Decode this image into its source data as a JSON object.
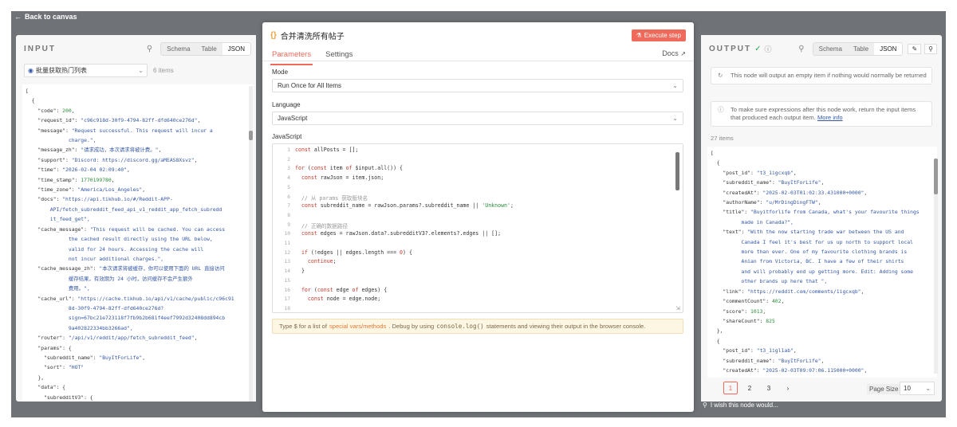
{
  "nav": {
    "back_label": "Back to canvas",
    "back_icon": "arrow-left-icon"
  },
  "input": {
    "title": "INPUT",
    "view_tabs": [
      "Schema",
      "Table",
      "JSON"
    ],
    "active_view": "JSON",
    "node_select": "批量获取热门列表",
    "items_count": "6 items",
    "json_lines": [
      "[",
      "  {",
      "    \"code\": 200,",
      "    \"request_id\": \"c96c918d-30f9-4794-82ff-dfd640ce276d\",",
      "    \"message\": \"Request successful. This request will incur a",
      "              charge.\",",
      "    \"message_zh\": \"请求成功，本次请求将被计费。\",",
      "    \"support\": \"Discord: https://discord.gg/aMEAS8Xsvz\",",
      "    \"time\": \"2026-02-04 02:09:40\",",
      "    \"time_stamp\": 1770199780,",
      "    \"time_zone\": \"America/Los_Angeles\",",
      "    \"docs\": \"https://api.tikhub.io/#/Reddit-APP-",
      "        API/fetch_subreddit_feed_api_v1_reddit_app_fetch_subredd",
      "        it_feed_get\",",
      "    \"cache_message\": \"This request will be cached. You can access",
      "              the cached result directly using the URL below,",
      "              valid for 24 hours. Accessing the cache will",
      "              not incur additional charges.\",",
      "    \"cache_message_zh\": \"本次请求将被缓存，你可以使用下面的 URL 直接访问",
      "              缓存结果，有效期为 24 小时，访问缓存不会产生额外",
      "              费用。\",",
      "    \"cache_url\": \"https://cache.tikhub.io/api/v1/cache/public/c96c91",
      "              8d-30f9-4794-82ff-dfd640ce276d?",
      "              sign=67bc21e723118f7fb9b2b681f4eef7992d32408dd894cb",
      "              9a402822334bb3266ad\",",
      "    \"router\": \"/api/v1/reddit/app/fetch_subreddit_feed\",",
      "    \"params\": {",
      "      \"subreddit_name\": \"BuyItForLife\",",
      "      \"sort\": \"HOT\"",
      "    },",
      "    \"data\": {",
      "      \"subredditV3\": {"
    ]
  },
  "modal": {
    "node_icon": "{}",
    "node_title": "合并清洗所有帖子",
    "execute_label": "Execute step",
    "tabs": [
      "Parameters",
      "Settings"
    ],
    "active_tab": "Parameters",
    "docs_label": "Docs",
    "mode_label": "Mode",
    "mode_value": "Run Once for All Items",
    "language_label": "Language",
    "language_value": "JavaScript",
    "code_label": "JavaScript",
    "code_lines": [
      "const allPosts = [];",
      "",
      "for (const item of $input.all()) {",
      "  const rawJson = item.json;",
      "",
      "  // 从 params 获取版块名",
      "  const subreddit_name = rawJson.params?.subreddit_name || 'Unknown';",
      "",
      "  // 正确的数据路径",
      "  const edges = rawJson.data?.subredditV3?.elements?.edges || [];",
      "",
      "  if (!edges || edges.length === 0) {",
      "    continue;",
      "  }",
      "",
      "  for (const edge of edges) {",
      "    const node = edge.node;",
      ""
    ],
    "hint_prefix": "Type $ for a list of",
    "hint_link": "special vars/methods",
    "hint_middle": ". Debug by using",
    "hint_code": "console.log()",
    "hint_suffix": "statements and viewing their output in the browser console."
  },
  "output": {
    "title": "OUTPUT",
    "view_tabs": [
      "Schema",
      "Table",
      "JSON"
    ],
    "active_view": "JSON",
    "notice1": "This node will output an empty item if nothing would normally be returned",
    "notice2": "To make sure expressions after this node work, return the input items that produced each output item.",
    "notice2_link": "More info",
    "items_count": "27 items",
    "json_lines": [
      "[",
      "  {",
      "    \"post_id\": \"t3_1igcxqb\",",
      "    \"subreddit_name\": \"BuyItForLife\",",
      "    \"createdAt\": \"2025-02-03T01:02:33.431000+0000\",",
      "    \"authorName\": \"u/MrDingDingFTW\",",
      "    \"title\": \"Buyitforlife from Canada, what's your favourite things",
      "          made in Canada?\",",
      "    \"text\": \"With the now starting trade war between the US and",
      "          Canada I feel it's best for us up north to support local",
      "          more than ever. One of my favourite clothing brands is",
      "          Anian from Victoria, BC. I have a few of their shirts",
      "          and will probably end up getting more. Edit: Adding some",
      "          other brands up here that \",",
      "    \"link\": \"https://reddit.com/comments/1igcxqb\",",
      "    \"commentCount\": 402,",
      "    \"score\": 1013,",
      "    \"shareCount\": 825",
      "  },",
      "  {",
      "    \"post_id\": \"t3_1igl1ab\",",
      "    \"subreddit_name\": \"BuyItForLife\",",
      "    \"createdAt\": \"2025-02-03T09:07:06.115000+0000\","
    ],
    "pages": [
      "1",
      "2",
      "3"
    ],
    "active_page": "1",
    "page_size_label": "Page Size",
    "page_size_value": "10"
  },
  "footer": {
    "wish_text": "I wish this node would..."
  },
  "colors": {
    "accent": "#ef6a5a",
    "string": "#3457a6",
    "number": "#2a8a3a",
    "success": "#2aa84a"
  }
}
